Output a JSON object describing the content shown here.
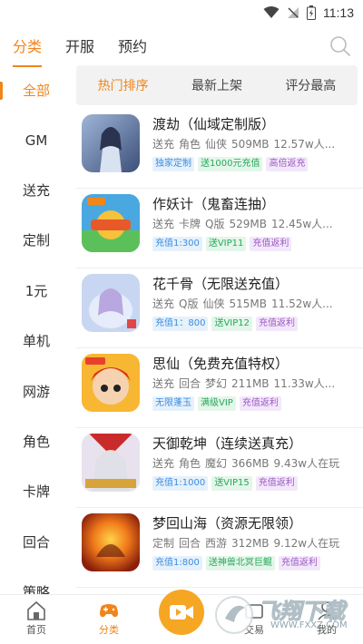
{
  "status_bar": {
    "time": "11:13"
  },
  "top_tabs": [
    {
      "label": "分类",
      "active": true
    },
    {
      "label": "开服",
      "active": false
    },
    {
      "label": "预约",
      "active": false
    }
  ],
  "sidebar": {
    "items": [
      "全部",
      "GM",
      "送充",
      "定制",
      "1元",
      "单机",
      "网游",
      "角色",
      "卡牌",
      "回合",
      "策略"
    ],
    "active_index": 0
  },
  "sort_tabs": [
    "热门排序",
    "最新上架",
    "评分最高"
  ],
  "games": [
    {
      "title": "渡劫（仙域定制版）",
      "meta": [
        "送充",
        "角色",
        "仙侠",
        "509MB",
        "12.57w人..."
      ],
      "tags": [
        {
          "text": "独家定制",
          "color": "blue"
        },
        {
          "text": "送1000元充值",
          "color": "green"
        },
        {
          "text": "高倍返充",
          "color": "purple"
        }
      ]
    },
    {
      "title": "作妖计（鬼畜连抽）",
      "meta": [
        "送充",
        "卡牌",
        "Q版",
        "529MB",
        "12.45w人..."
      ],
      "tags": [
        {
          "text": "充值1:300",
          "color": "blue"
        },
        {
          "text": "送VIP11",
          "color": "green"
        },
        {
          "text": "充值返利",
          "color": "purple"
        }
      ]
    },
    {
      "title": "花千骨（无限送充值）",
      "meta": [
        "送充",
        "Q版",
        "仙侠",
        "515MB",
        "11.52w人..."
      ],
      "tags": [
        {
          "text": "充值1：800",
          "color": "blue"
        },
        {
          "text": "送VIP12",
          "color": "green"
        },
        {
          "text": "充值返利",
          "color": "purple"
        }
      ]
    },
    {
      "title": "思仙（免费充值特权）",
      "meta": [
        "送充",
        "回合",
        "梦幻",
        "211MB",
        "11.33w人..."
      ],
      "tags": [
        {
          "text": "无限蓬玉",
          "color": "blue"
        },
        {
          "text": "满级VIP",
          "color": "green"
        },
        {
          "text": "充值返利",
          "color": "purple"
        }
      ]
    },
    {
      "title": "天御乾坤（连续送真充）",
      "meta": [
        "送充",
        "角色",
        "魔幻",
        "366MB",
        "9.43w人在玩"
      ],
      "tags": [
        {
          "text": "充值1:1000",
          "color": "blue"
        },
        {
          "text": "送VIP15",
          "color": "green"
        },
        {
          "text": "充值返利",
          "color": "purple"
        }
      ]
    },
    {
      "title": "梦回山海（资源无限领）",
      "meta": [
        "定制",
        "回合",
        "西游",
        "312MB",
        "9.12w人在玩"
      ],
      "tags": [
        {
          "text": "充值1:800",
          "color": "blue"
        },
        {
          "text": "送神兽北冥巨鲲",
          "color": "green"
        },
        {
          "text": "充值返利",
          "color": "purple"
        }
      ]
    }
  ],
  "bottom_nav": {
    "home": "首页",
    "category": "分类",
    "trade": "交易",
    "mine": "我的"
  },
  "watermark": {
    "brand": "飞翔下载",
    "url": "WWW.FXXZ.COM"
  },
  "colors": {
    "accent": "#f08519",
    "fab": "#f5a623"
  }
}
